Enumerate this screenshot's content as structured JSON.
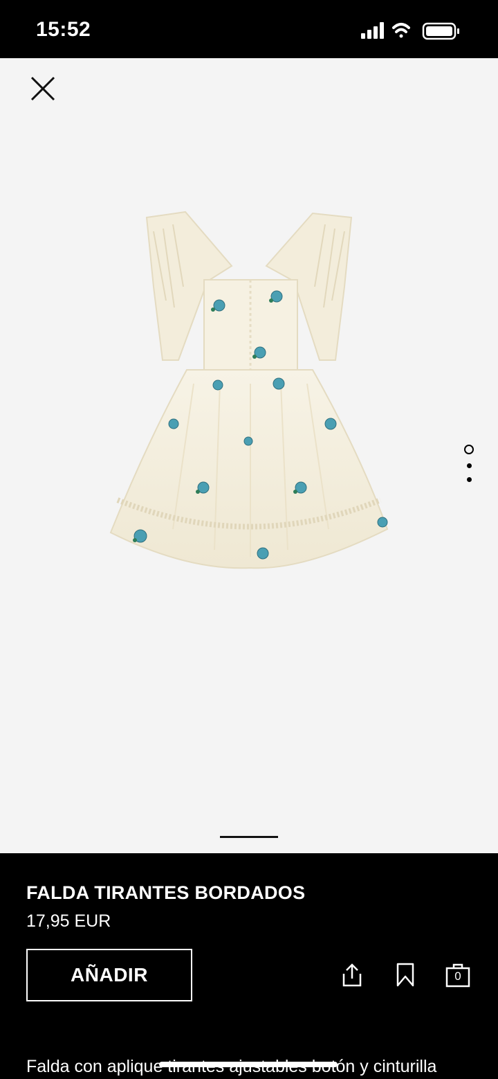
{
  "status_bar": {
    "time": "15:52",
    "icons": [
      "signal-icon",
      "wifi-icon",
      "battery-icon"
    ]
  },
  "image_viewer": {
    "close_icon": "close-icon",
    "pager": {
      "count": 3,
      "active_index": 0
    }
  },
  "product": {
    "title": "FALDA TIRANTES BORDADOS",
    "price": "17,95 EUR",
    "add_label": "AÑADIR",
    "description": "Falda con aplique tirantes ajustables botón y cinturilla",
    "actions": [
      "share-icon",
      "bookmark-icon",
      "bag-icon"
    ],
    "bag_count": "0"
  },
  "colors": {
    "background_dark": "#000000",
    "image_background": "#f4f4f4",
    "garment": "#f4efdf",
    "embroidery": "#4a9fb3"
  }
}
